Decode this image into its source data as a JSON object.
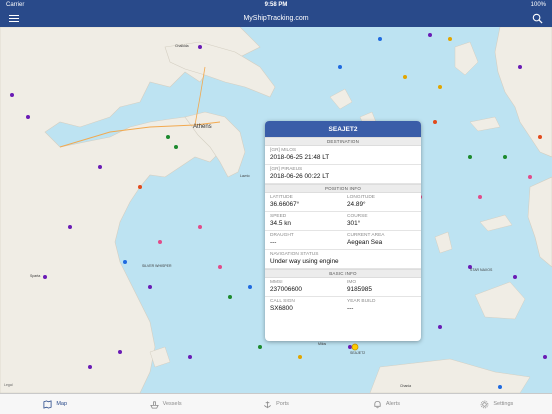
{
  "status_bar": {
    "carrier": "Carrier",
    "time": "9:58 PM",
    "battery": "100%"
  },
  "nav": {
    "title": "MyShipTracking.com",
    "menu_icon": "hamburger-menu-icon",
    "search_icon": "search-icon"
  },
  "map": {
    "city_label": "Athens",
    "place_labels": [
      "Chalkida",
      "Sparta",
      "Lavrio",
      "Tinos",
      "Milos",
      "Chania"
    ],
    "ship_labels": [
      "SILVER WHISPER",
      "STAR NAXOS",
      "SEAJET2"
    ],
    "legal": "Legal"
  },
  "popup": {
    "ship_name": "SEAJET2",
    "sections": {
      "destination": "DESTINATION",
      "position": "POSITION INFO",
      "basic": "BASIC INFO"
    },
    "from_port": "[GR] MILOS",
    "from_time": "2018-06-25 21:48 LT",
    "to_port": "[GR] PIRAEUS",
    "to_time": "2018-06-26 00:22 LT",
    "latitude_label": "LATITUDE",
    "latitude": "36.66067°",
    "longitude_label": "LONGITUDE",
    "longitude": "24.89°",
    "speed_label": "SPEED",
    "speed": "34.5 kn",
    "course_label": "COURSE",
    "course": "301°",
    "draught_label": "DRAUGHT",
    "draught": "---",
    "area_label": "CURRENT AREA",
    "area": "Aegean Sea",
    "nav_status_label": "NAVIGATION STATUS",
    "nav_status": "Under way using engine",
    "mmsi_label": "MMSI",
    "mmsi": "237006600",
    "imo_label": "IMO",
    "imo": "9185985",
    "callsign_label": "CALL SIGN",
    "callsign": "SX6800",
    "year_label": "YEAR BUILD",
    "year": "---"
  },
  "tabs": [
    {
      "label": "Map",
      "icon": "map-icon"
    },
    {
      "label": "Vessels",
      "icon": "ship-icon"
    },
    {
      "label": "Ports",
      "icon": "anchor-icon"
    },
    {
      "label": "Alerts",
      "icon": "bell-icon"
    },
    {
      "label": "Settings",
      "icon": "gear-icon"
    }
  ],
  "colors": {
    "nav_bg": "#294a8a",
    "popup_header": "#3a5da8",
    "sea": "#bde3f2",
    "land": "#f0ede5",
    "active_tab": "#294a8a"
  }
}
